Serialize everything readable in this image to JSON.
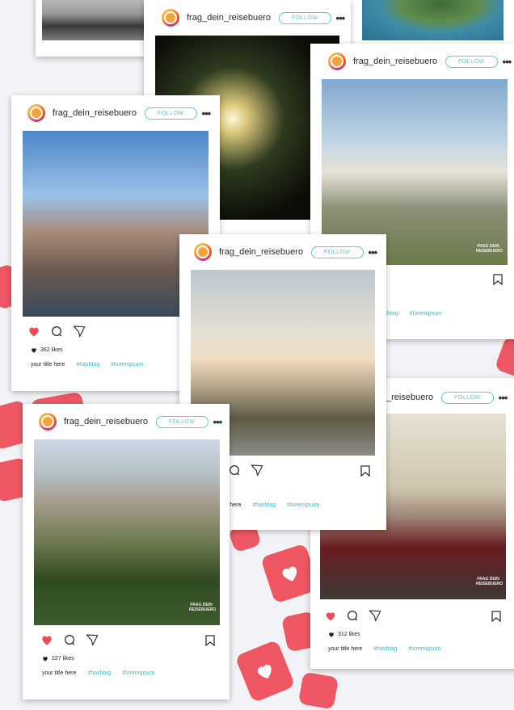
{
  "user": {
    "username": "frag_dein_reisebuero",
    "follow_label": "FOLLOW"
  },
  "watermark": "FRAG DEIN REISEBUERO",
  "posts": {
    "p1": {
      "likes": "362 likes",
      "title": "your title here",
      "tag1": "#hashtag",
      "tag2": "#loremipsum"
    },
    "p2": {
      "title": "your title here",
      "tag1": "#hashtag",
      "tag2": "#loremipsum"
    },
    "p3": {
      "tag1": "#hashtag",
      "tag2": "#loremipsum"
    },
    "p4": {
      "likes": "312 likes",
      "title": "your title here",
      "tag1": "#hashtag",
      "tag2": "#loremipsum"
    },
    "p5": {
      "likes": "227 likes",
      "title": "your title here",
      "tag1": "#hashtag",
      "tag2": "#loremipsum"
    },
    "p6": {
      "username_partial": "_reisebuero"
    }
  },
  "colors": {
    "like_red": "#ee4a56",
    "follow_cyan": "#4fcfe0",
    "hashtag": "#3db8c8"
  }
}
